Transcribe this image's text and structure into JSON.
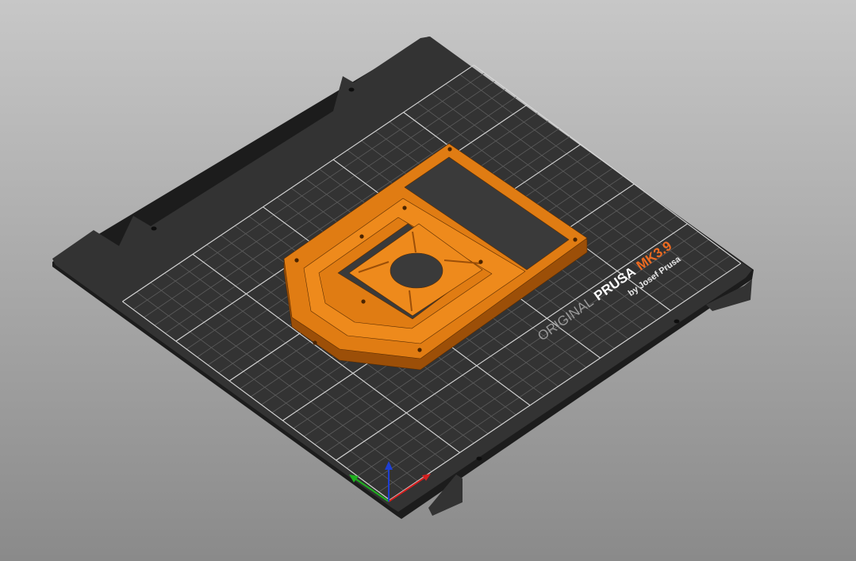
{
  "view": {
    "background_top": "#c7c7c7",
    "background_bottom": "#8a8a8a"
  },
  "bed": {
    "color": "#333333",
    "edge_color": "#1c1c1c",
    "grid_minor_color": "#5c5c5c",
    "grid_major_color": "#d8d8d8",
    "logo": {
      "brand_prefix": "ORIGINAL",
      "brand_name": "PRUSA",
      "model": "MK3.9",
      "byline": "by Josef Prusa",
      "prefix_color": "#9a9a9a",
      "name_color": "#ffffff",
      "model_color": "#ed6b21",
      "byline_color": "#e8e8e8"
    }
  },
  "model": {
    "color": "#e07c13",
    "top_color": "#ee8a1c",
    "side_color": "#9c4f08",
    "edge_color": "#5a2d03"
  },
  "axes": {
    "x_color": "#d42020",
    "y_color": "#1fb01f",
    "z_color": "#1e3fd4"
  }
}
